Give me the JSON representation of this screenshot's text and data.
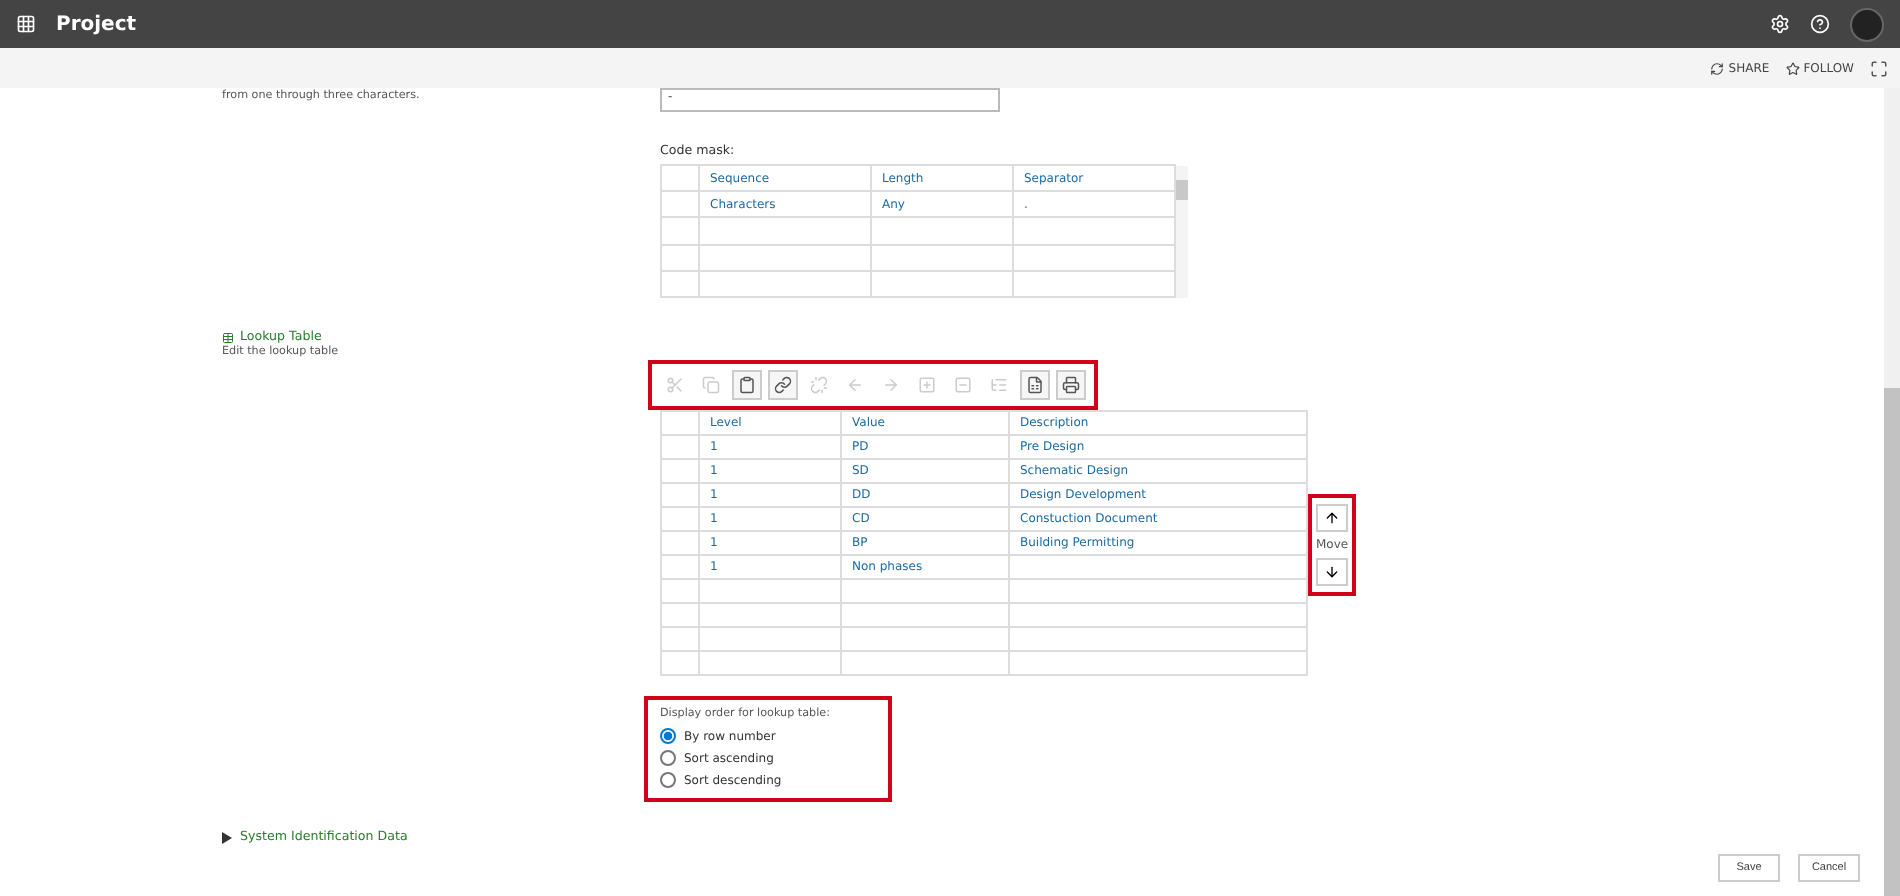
{
  "header": {
    "title": "Project"
  },
  "subbar": {
    "actions": [
      {
        "kind": "share",
        "label": "SHARE"
      },
      {
        "kind": "follow",
        "label": "FOLLOW"
      }
    ]
  },
  "separator": {
    "help_text": "from one through three characters.",
    "value": "-"
  },
  "code_mask": {
    "label": "Code mask:",
    "columns": [
      "Sequence",
      "Length",
      "Separator"
    ],
    "rows": [
      [
        "Characters",
        "Any",
        "."
      ]
    ]
  },
  "lookup": {
    "title": "Lookup Table",
    "description": "Edit the lookup table",
    "tools": [
      {
        "kind": "cut",
        "disabled": true
      },
      {
        "kind": "copy",
        "disabled": true
      },
      {
        "kind": "paste",
        "disabled": false
      },
      {
        "kind": "link",
        "disabled": false
      },
      {
        "kind": "unlink",
        "disabled": true
      },
      {
        "kind": "outdent",
        "disabled": true
      },
      {
        "kind": "indent",
        "disabled": true
      },
      {
        "kind": "expand",
        "disabled": true
      },
      {
        "kind": "collapse",
        "disabled": true
      },
      {
        "kind": "expandall",
        "disabled": true
      },
      {
        "kind": "excel",
        "disabled": false
      },
      {
        "kind": "print",
        "disabled": false
      }
    ],
    "columns": [
      "Level",
      "Value",
      "Description"
    ],
    "rows": [
      [
        "1",
        "PD",
        "Pre Design"
      ],
      [
        "1",
        "SD",
        "Schematic Design"
      ],
      [
        "1",
        "DD",
        "Design Development"
      ],
      [
        "1",
        "CD",
        "Constuction Document"
      ],
      [
        "1",
        "BP",
        "Building Permitting"
      ],
      [
        "1",
        "Non phases"
      ]
    ],
    "move_label": "Move"
  },
  "display_order": {
    "label": "Display order for lookup table:",
    "options": [
      {
        "label": "By row number",
        "selected": true
      },
      {
        "label": "Sort ascending",
        "selected": false
      },
      {
        "label": "Sort descending",
        "selected": false
      }
    ]
  },
  "system_section": {
    "title": "System Identification Data",
    "expanded": false
  },
  "buttons": [
    "Save",
    "Cancel"
  ]
}
